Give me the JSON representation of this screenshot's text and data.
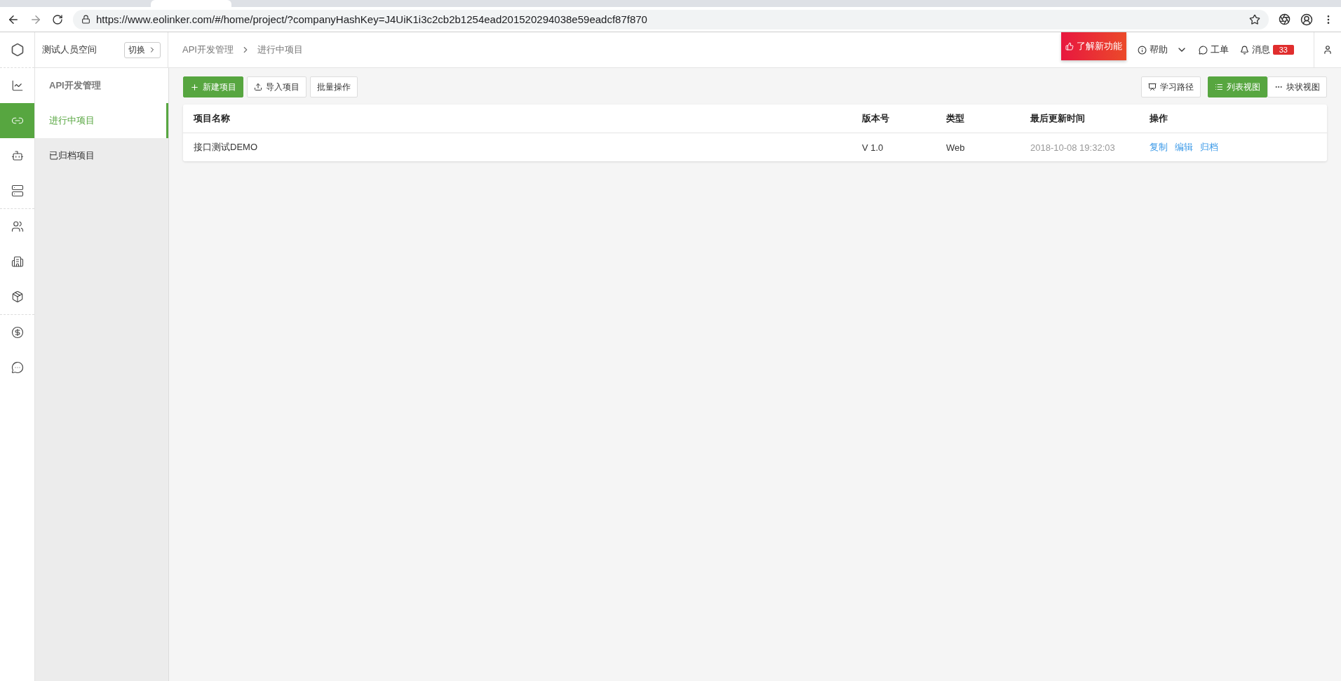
{
  "browser": {
    "url": "https://www.eolinker.com/#/home/project/?companyHashKey=J4UiK1i3c2cb2b1254ead201520294038e59eadcf87f870"
  },
  "rail": [
    {
      "kind": "chart",
      "selected": false
    },
    {
      "kind": "link",
      "selected": true
    },
    {
      "kind": "robot",
      "selected": false
    },
    {
      "kind": "server",
      "selected": false
    },
    {
      "kind": "divider"
    },
    {
      "kind": "users",
      "selected": false
    },
    {
      "kind": "building",
      "selected": false
    },
    {
      "kind": "box",
      "selected": false
    },
    {
      "kind": "divider"
    },
    {
      "kind": "coin",
      "selected": false
    },
    {
      "kind": "chat",
      "selected": false
    }
  ],
  "workspace": {
    "name": "测试人员空间",
    "switch": "切换"
  },
  "breadcrumb": [
    "API开发管理",
    "进行中项目"
  ],
  "header_actions": {
    "promo": "了解新功能",
    "help": "帮助",
    "tickets": "工单",
    "messages": "消息",
    "message_count": "33"
  },
  "sidebar": {
    "title": "API开发管理",
    "items": [
      {
        "label": "进行中项目",
        "selected": true
      },
      {
        "label": "已归档项目",
        "selected": false
      }
    ]
  },
  "toolbar": {
    "new": "新建项目",
    "import": "导入项目",
    "batch": "批量操作",
    "learn": "学习路径",
    "views": [
      {
        "label": "列表视图",
        "kind": "list",
        "selected": true
      },
      {
        "label": "块状视图",
        "kind": "block",
        "selected": false
      }
    ]
  },
  "table": {
    "columns": [
      "项目名称",
      "版本号",
      "类型",
      "最后更新时间",
      "操作"
    ],
    "rows": [
      {
        "name": "接口测试DEMO",
        "version": "V 1.0",
        "type": "Web",
        "updated": "2018-10-08 19:32:03",
        "actions": [
          "复制",
          "编辑",
          "归档"
        ]
      }
    ]
  }
}
